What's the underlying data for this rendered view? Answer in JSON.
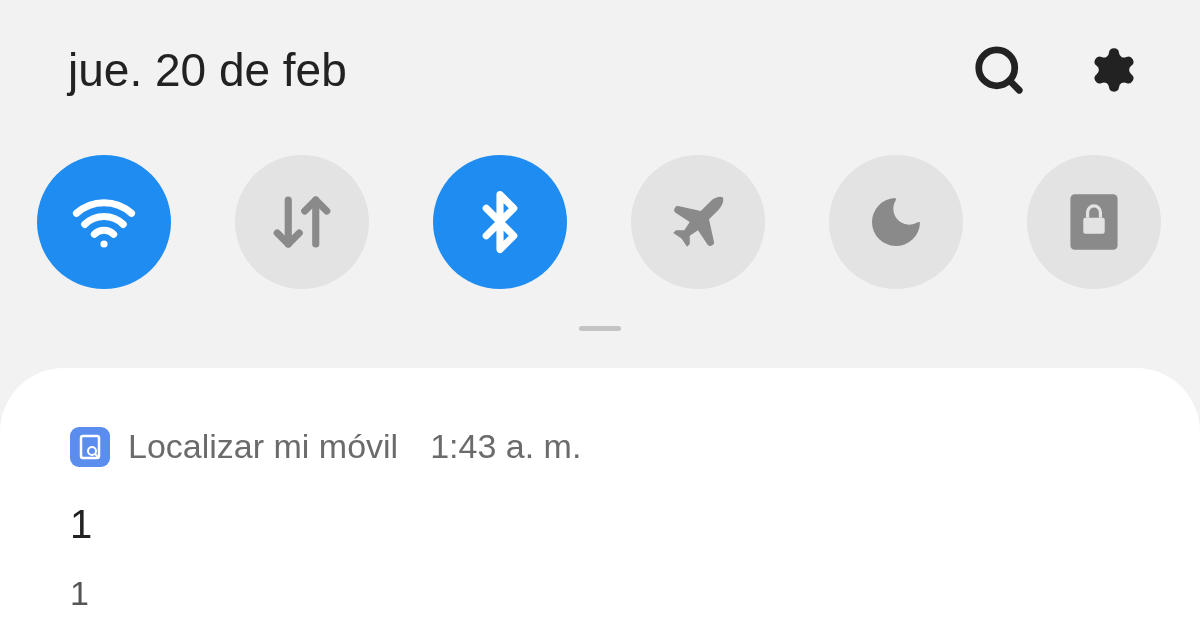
{
  "date": "jue. 20 de feb",
  "toggles": [
    {
      "kind": "wifi",
      "on": true
    },
    {
      "kind": "data",
      "on": false
    },
    {
      "kind": "bluetooth",
      "on": true
    },
    {
      "kind": "airplane",
      "on": false
    },
    {
      "kind": "night",
      "on": false
    },
    {
      "kind": "secure",
      "on": false
    }
  ],
  "notification": {
    "app": "Localizar mi móvil",
    "time": "1:43 a. m.",
    "title": "1",
    "body": "1"
  }
}
